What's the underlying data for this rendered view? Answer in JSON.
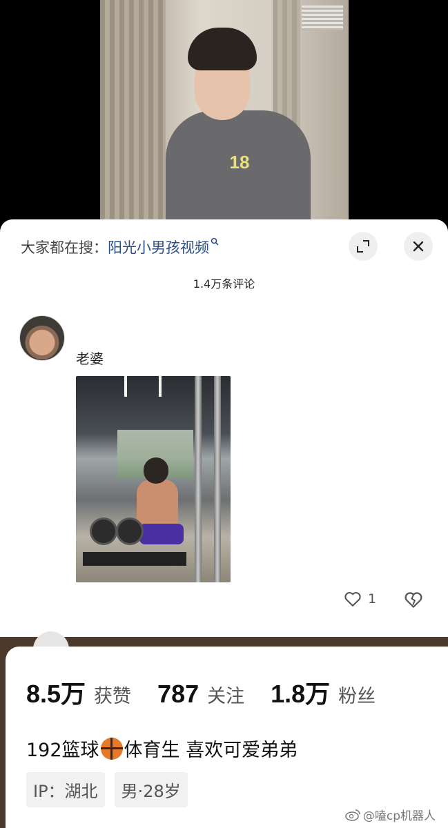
{
  "search": {
    "prefix": "大家都在搜：",
    "term": "阳光小男孩视频",
    "icon": "search-icon"
  },
  "comments": {
    "count_label": "1.4万条评论",
    "items": [
      {
        "author": "老婆",
        "likes": "1"
      }
    ]
  },
  "profile": {
    "stats": [
      {
        "value": "8.5万",
        "label": "获赞"
      },
      {
        "value": "787",
        "label": "关注"
      },
      {
        "value": "1.8万",
        "label": "粉丝"
      }
    ],
    "bio_part1": "192篮球",
    "bio_part2": "体育生 喜欢可爱弟弟",
    "tags": [
      "IP：湖北",
      "男·28岁"
    ]
  },
  "video_print": "18",
  "watermark": "@嗑cp机器人",
  "colors": {
    "search_term": "#2c4f86",
    "sheet_background": "#ffffff",
    "border_brown": "#4b3a2c"
  }
}
